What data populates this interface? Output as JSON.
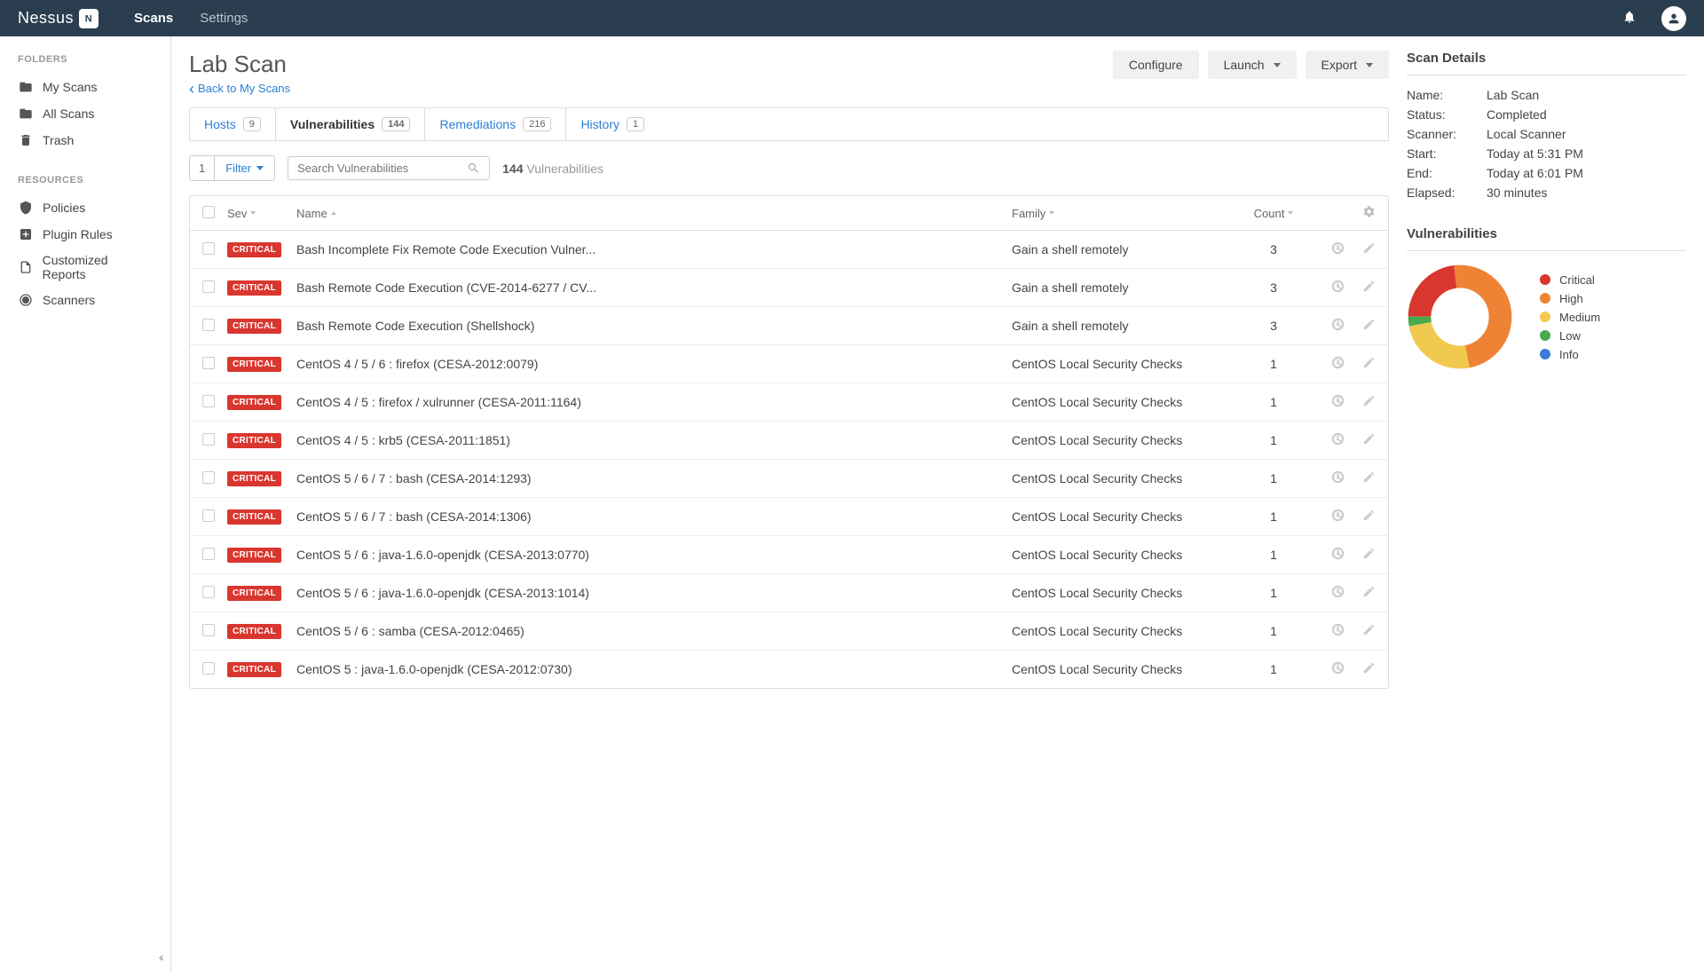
{
  "brand": "Nessus",
  "topnav": {
    "scans": "Scans",
    "settings": "Settings"
  },
  "sidebar": {
    "folders_heading": "FOLDERS",
    "resources_heading": "RESOURCES",
    "my_scans": "My Scans",
    "all_scans": "All Scans",
    "trash": "Trash",
    "policies": "Policies",
    "plugin_rules": "Plugin Rules",
    "customized_reports": "Customized Reports",
    "scanners": "Scanners"
  },
  "page": {
    "title": "Lab Scan",
    "back": "Back to My Scans",
    "configure": "Configure",
    "launch": "Launch",
    "export": "Export"
  },
  "tabs": {
    "hosts": {
      "label": "Hosts",
      "count": "9"
    },
    "vulns": {
      "label": "Vulnerabilities",
      "count": "144"
    },
    "remed": {
      "label": "Remediations",
      "count": "216"
    },
    "history": {
      "label": "History",
      "count": "1"
    }
  },
  "filter": {
    "count": "1",
    "label": "Filter",
    "search_placeholder": "Search Vulnerabilities",
    "total_count": "144",
    "total_label": "Vulnerabilities"
  },
  "columns": {
    "sev": "Sev",
    "name": "Name",
    "family": "Family",
    "count": "Count"
  },
  "rows": [
    {
      "sev": "CRITICAL",
      "name": "Bash Incomplete Fix Remote Code Execution Vulner...",
      "family": "Gain a shell remotely",
      "count": "3"
    },
    {
      "sev": "CRITICAL",
      "name": "Bash Remote Code Execution (CVE-2014-6277 / CV...",
      "family": "Gain a shell remotely",
      "count": "3"
    },
    {
      "sev": "CRITICAL",
      "name": "Bash Remote Code Execution (Shellshock)",
      "family": "Gain a shell remotely",
      "count": "3"
    },
    {
      "sev": "CRITICAL",
      "name": "CentOS 4 / 5 / 6 : firefox (CESA-2012:0079)",
      "family": "CentOS Local Security Checks",
      "count": "1"
    },
    {
      "sev": "CRITICAL",
      "name": "CentOS 4 / 5 : firefox / xulrunner (CESA-2011:1164)",
      "family": "CentOS Local Security Checks",
      "count": "1"
    },
    {
      "sev": "CRITICAL",
      "name": "CentOS 4 / 5 : krb5 (CESA-2011:1851)",
      "family": "CentOS Local Security Checks",
      "count": "1"
    },
    {
      "sev": "CRITICAL",
      "name": "CentOS 5 / 6 / 7 : bash (CESA-2014:1293)",
      "family": "CentOS Local Security Checks",
      "count": "1"
    },
    {
      "sev": "CRITICAL",
      "name": "CentOS 5 / 6 / 7 : bash (CESA-2014:1306)",
      "family": "CentOS Local Security Checks",
      "count": "1"
    },
    {
      "sev": "CRITICAL",
      "name": "CentOS 5 / 6 : java-1.6.0-openjdk (CESA-2013:0770)",
      "family": "CentOS Local Security Checks",
      "count": "1"
    },
    {
      "sev": "CRITICAL",
      "name": "CentOS 5 / 6 : java-1.6.0-openjdk (CESA-2013:1014)",
      "family": "CentOS Local Security Checks",
      "count": "1"
    },
    {
      "sev": "CRITICAL",
      "name": "CentOS 5 / 6 : samba (CESA-2012:0465)",
      "family": "CentOS Local Security Checks",
      "count": "1"
    },
    {
      "sev": "CRITICAL",
      "name": "CentOS 5 : java-1.6.0-openjdk (CESA-2012:0730)",
      "family": "CentOS Local Security Checks",
      "count": "1"
    }
  ],
  "details": {
    "heading": "Scan Details",
    "name_label": "Name:",
    "name_value": "Lab Scan",
    "status_label": "Status:",
    "status_value": "Completed",
    "scanner_label": "Scanner:",
    "scanner_value": "Local Scanner",
    "start_label": "Start:",
    "start_value": "Today at 5:31 PM",
    "end_label": "End:",
    "end_value": "Today at 6:01 PM",
    "elapsed_label": "Elapsed:",
    "elapsed_value": "30 minutes"
  },
  "vuln_panel": {
    "heading": "Vulnerabilities",
    "legend": {
      "critical": "Critical",
      "high": "High",
      "medium": "Medium",
      "low": "Low",
      "info": "Info"
    }
  },
  "colors": {
    "critical": "#d9362f",
    "high": "#ee8336",
    "medium": "#f1c94e",
    "low": "#49a94d",
    "info": "#3a7bd5"
  },
  "chart_data": {
    "type": "pie",
    "title": "Vulnerabilities",
    "series": [
      {
        "name": "Critical",
        "value": 23,
        "color": "#d9362f"
      },
      {
        "name": "High",
        "value": 49,
        "color": "#ee8336"
      },
      {
        "name": "Medium",
        "value": 25,
        "color": "#f1c94e"
      },
      {
        "name": "Low",
        "value": 3,
        "color": "#49a94d"
      },
      {
        "name": "Info",
        "value": 0,
        "color": "#3a7bd5"
      }
    ]
  }
}
